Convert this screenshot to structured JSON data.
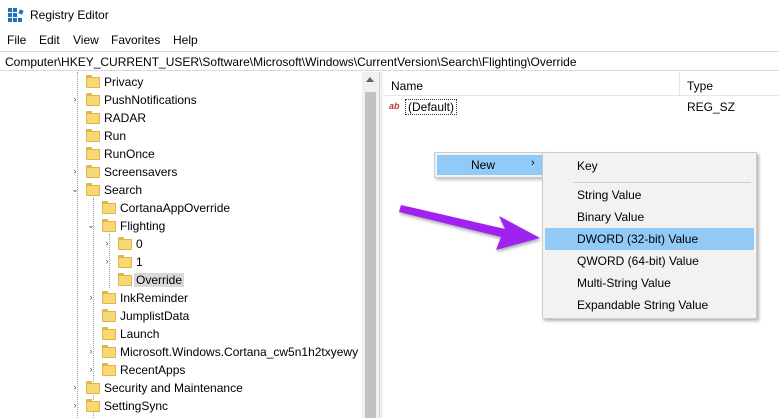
{
  "window": {
    "title": "Registry Editor"
  },
  "menu": [
    "File",
    "Edit",
    "View",
    "Favorites",
    "Help"
  ],
  "address": "Computer\\HKEY_CURRENT_USER\\Software\\Microsoft\\Windows\\CurrentVersion\\Search\\Flighting\\Override",
  "tree": {
    "items": [
      {
        "label": "Privacy",
        "expander": ""
      },
      {
        "label": "PushNotifications",
        "expander": "›"
      },
      {
        "label": "RADAR",
        "expander": ""
      },
      {
        "label": "Run",
        "expander": ""
      },
      {
        "label": "RunOnce",
        "expander": ""
      },
      {
        "label": "Screensavers",
        "expander": "›"
      },
      {
        "label": "Search",
        "expander": "⌄"
      },
      {
        "label": "CortanaAppOverride",
        "expander": ""
      },
      {
        "label": "Flighting",
        "expander": "⌄"
      },
      {
        "label": "0",
        "expander": "›"
      },
      {
        "label": "1",
        "expander": "›"
      },
      {
        "label": "Override",
        "expander": "",
        "selected": true
      },
      {
        "label": "InkReminder",
        "expander": "›"
      },
      {
        "label": "JumplistData",
        "expander": ""
      },
      {
        "label": "Launch",
        "expander": ""
      },
      {
        "label": "Microsoft.Windows.Cortana_cw5n1h2txyewy",
        "expander": "›"
      },
      {
        "label": "RecentApps",
        "expander": "›"
      },
      {
        "label": "Security and Maintenance",
        "expander": "›"
      },
      {
        "label": "SettingSync",
        "expander": "›"
      }
    ]
  },
  "list": {
    "headers": {
      "name": "Name",
      "type": "Type"
    },
    "rows": [
      {
        "name": "(Default)",
        "type": "REG_SZ",
        "icon": "ab-string-icon"
      }
    ]
  },
  "context_menu": {
    "new_label": "New",
    "submenu_arrow": "›"
  },
  "submenu": {
    "items": [
      "Key",
      "String Value",
      "Binary Value",
      "DWORD (32-bit) Value",
      "QWORD (64-bit) Value",
      "Multi-String Value",
      "Expandable String Value"
    ],
    "highlighted": "DWORD (32-bit) Value"
  },
  "colors": {
    "highlight": "#91c9f7",
    "arrow": "#a020f0",
    "folder": "#f8d775"
  }
}
